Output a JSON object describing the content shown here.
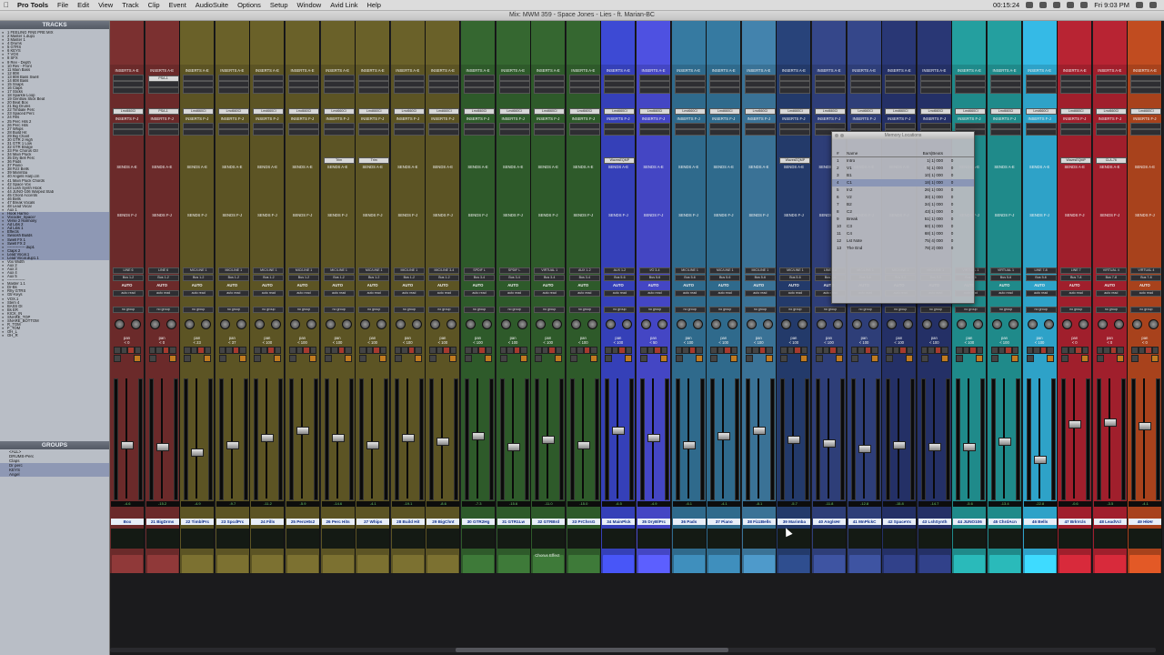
{
  "menubar": {
    "app": "Pro Tools",
    "items": [
      "File",
      "Edit",
      "View",
      "Track",
      "Clip",
      "Event",
      "AudioSuite",
      "Options",
      "Setup",
      "Window",
      "Avid Link",
      "Help"
    ],
    "time_code": "00:15:24",
    "clock": "Fri 9:03 PM"
  },
  "window": {
    "title": "Mix: MWM 359 - Space Jones - Lies - ft. Marian-BC"
  },
  "tracks_panel": {
    "header": "TRACKS",
    "items": [
      "1 FEELING FINE PRE MIX",
      "2 Master 1.dup1",
      "3 Master 1",
      "4 Drums",
      "5 GTRS",
      "6 KEYS",
      "7 VOX",
      "8 SFX",
      "9 Rev - Depth",
      "10 Rev - Front",
      "11 Main Bass",
      "12 808",
      "13 808 Bass Swell",
      "14 808 Bass",
      "15 Snaps",
      "16 Claps",
      "17 Sticks",
      "18 Sparkle Loop",
      "19 Gentlow Stick Beat",
      "20 Beat Box",
      "21 Big Drums",
      "22 Timbale Perc",
      "23 Spaced Perc",
      "24 Fills",
      "25 Perc Hits 2",
      "26 Perc Hits",
      "27 Whips",
      "28 Build Hit",
      "29 Big Chant",
      "30 GTR 2 High",
      "31 GTR 1 Low",
      "32 GTR Bridge",
      "33 Pre Chorus Gtr",
      "34 Main Pluck",
      "35 Dry Bell Perc",
      "36 Pads",
      "37 Piano",
      "38 Fizz Bells",
      "39 Marimba",
      "40 Angels Harp.cm",
      "41 Main Pluck Chords",
      "42 Space Vox",
      "43 Lush Synth Hook",
      "44 JUNO-106 Warped Stab",
      "45 Chord Accents",
      "46 Bells",
      "47 Break Vocals",
      "48 Lead Vocal",
      "Aux 1",
      "Hook Harmo",
      "Vocoder_Space/",
      "Verse 2 Harmony",
      "Ad Libs 2",
      "Ad Libs 1",
      "Effects",
      "Swoosh Builds",
      "Swell FX 1",
      "Swell FX 2",
      "-------------- dup1",
      "Claps 2",
      "Lead Vocal.1",
      "Lead Vocal.dup1.1",
      "Vox Width",
      "Aux 2",
      "Aux 3",
      "Aux 4",
      "Aux 5",
      "--------------",
      "Master 1.1",
      "Dr-Bs",
      "Rhy GTRS",
      "Gtr-Keys",
      "VOX.1",
      "Stem 4",
      "BASS DI",
      "Bs ER",
      "KICK_IN",
      "SNARE_TOP",
      "SNARE_BOTTOM",
      "R_TOM",
      "F_TOM",
      "OH_L",
      "OH_R"
    ]
  },
  "groups_panel": {
    "header": "GROUPS",
    "items": [
      "<ALL>",
      "DRUMS-Perc",
      "Claps",
      "Dr perc",
      "KEYS",
      "Angel"
    ]
  },
  "mixer": {
    "section_labels": {
      "inserts_a": "INSERTS A-E",
      "inserts_f": "INSERTS F-J",
      "sends_a": "SENDS A-E",
      "sends_f": "SENDS F-J"
    },
    "io_auto": "AUTO",
    "auto_mode": "auto read",
    "group": "no group",
    "pan": "pan",
    "strips": [
      {
        "name": "Box",
        "color": "#6b2a2a",
        "input": "LINE 6",
        "output": "Bus 1-2",
        "insert": "Lmd660Cl",
        "db": "-4.6",
        "pan": "< 0",
        "extra": "",
        "vol_val": ""
      },
      {
        "name": "21 BigDrms",
        "color": "#6b2a2a",
        "input": "LINE 6",
        "output": "Bus 1-2",
        "insert": "PSA-1",
        "db": "-15.2",
        "pan": "< 0",
        "extra": "",
        "vol_val": ""
      },
      {
        "name": "22 TimblPrc",
        "color": "#5c5424",
        "input": "MIC/LINE 1",
        "output": "Bus 1-2",
        "insert": "Lmd660Cl",
        "db": "-4.9",
        "pan": "< 23",
        "extra": "",
        "vol_val": ""
      },
      {
        "name": "23 SpcdPrc",
        "color": "#5c5424",
        "input": "MIC/LINE 1",
        "output": "Bus 1-2",
        "insert": "Lmd660Cl",
        "db": "-9.7",
        "pan": "< 37",
        "extra": "",
        "vol_val": ""
      },
      {
        "name": "24 Fills",
        "color": "#5c5424",
        "input": "MIC/LINE 1",
        "output": "Bus 1-2",
        "insert": "Lmd660Cl",
        "db": "-11.2",
        "pan": "< 100",
        "extra": "",
        "vol_val": ""
      },
      {
        "name": "25 PercHts2",
        "color": "#5c5424",
        "input": "MIC/LINE 1",
        "output": "Bus 1-2",
        "insert": "Lmd660Cl",
        "db": "-5.9",
        "pan": "< 100",
        "extra": "",
        "vol_val": ""
      },
      {
        "name": "26 Perc Hits",
        "color": "#5c5424",
        "input": "MIC/LINE 1",
        "output": "Bus 1-2",
        "insert": "Lmd660Cl",
        "db": "-14.6",
        "pan": "< 100",
        "extra": "Trim",
        "vol_val": ""
      },
      {
        "name": "27 Whips",
        "color": "#5c5424",
        "input": "MIC/LINE 1",
        "output": "Bus 1-2",
        "insert": "Lmd660Cl",
        "db": "-4.1",
        "pan": "< 100",
        "extra": "Trim",
        "vol_val": ""
      },
      {
        "name": "28 Build Hit",
        "color": "#5c5424",
        "input": "MIC/LINE 1",
        "output": "Bus 1-2",
        "insert": "Lmd660Cl",
        "db": "-19.1",
        "pan": "< 100",
        "extra": "",
        "vol_val": ""
      },
      {
        "name": "29 BigChnt",
        "color": "#5c5424",
        "input": "MIC/LINE 3-4",
        "output": "Bus 1-2",
        "insert": "Lmd660Cl",
        "db": "-8.6",
        "pan": "< 100",
        "extra": "",
        "vol_val": ""
      },
      {
        "name": "30 GTR2Hg",
        "color": "#2e5a2a",
        "input": "SPDIF L",
        "output": "Bus 3-4",
        "insert": "Lmd660Cl",
        "db": "-7.3",
        "pan": "< 100",
        "extra": "",
        "vol_val": ""
      },
      {
        "name": "31 GTR1Lw",
        "color": "#2e5a2a",
        "input": "SPDIF L",
        "output": "Bus 3-4",
        "insert": "Lmd660Cl",
        "db": "-15.6",
        "pan": "< 100",
        "extra": "",
        "vol_val": ""
      },
      {
        "name": "32 GTRBrd",
        "color": "#2e5a2a",
        "input": "VIRTUAL 1",
        "output": "Bus 3-4",
        "insert": "Lmd660Cl",
        "db": "-11.0",
        "pan": "< 100",
        "extra": "",
        "vol_val": ""
      },
      {
        "name": "33 PrChrsG",
        "color": "#2e5a2a",
        "input": "AUX 1-2",
        "output": "Bus 3-4",
        "insert": "Lmd660Cl",
        "db": "-15.0",
        "pan": "< 100",
        "extra": "",
        "vol_val": ""
      },
      {
        "name": "34 MainPlck",
        "color": "#3540b8",
        "input": "AUX 1-2",
        "output": "Bus 5-6",
        "insert": "Lmd660Cl",
        "db": "-6.5",
        "pan": "< 100",
        "extra": "WavesEQMP",
        "vol_val": ""
      },
      {
        "name": "35 DryBlPrc",
        "color": "#4446c4",
        "input": "I/O 3-4",
        "output": "Bus 5-6",
        "insert": "Lmd660Cl",
        "db": "-4.9",
        "pan": "< 50",
        "extra": "",
        "vol_val": ""
      },
      {
        "name": "36 Pads",
        "color": "#2f6a8c",
        "input": "MIC/LINE 1",
        "output": "Bus 5-6",
        "insert": "Lmd660Cl",
        "db": "-6.1",
        "pan": "< 100",
        "extra": "",
        "vol_val": ""
      },
      {
        "name": "37 Piano",
        "color": "#2f6a8c",
        "input": "MIC/LINE 1",
        "output": "Bus 5-6",
        "insert": "Lmd660Cl",
        "db": "-4.1",
        "pan": "< 100",
        "extra": "",
        "vol_val": ""
      },
      {
        "name": "38 FizzBells",
        "color": "#3a7296",
        "input": "MIC/LINE 1",
        "output": "Bus 5-6",
        "insert": "Lmd660Cl",
        "db": "-8.1",
        "pan": "< 100",
        "extra": "",
        "vol_val": ""
      },
      {
        "name": "39 Marimba",
        "color": "#233a6a",
        "input": "MIC/LINE 1",
        "output": "Bus 5-6",
        "insert": "Lmd660Cl",
        "db": "-5.7",
        "pan": "< 100",
        "extra": "WavesEQMP",
        "vol_val": ""
      },
      {
        "name": "40 AnglsHr",
        "color": "#2e3e78",
        "input": "LINE 5-6",
        "output": "Bus 5-6",
        "insert": "Lmd660Cl",
        "db": "-11.8",
        "pan": "< 100",
        "extra": "",
        "vol_val": ""
      },
      {
        "name": "41 MnPlckC",
        "color": "#2e3e78",
        "input": "MIC/LINE 1",
        "output": "Bus 5-6",
        "insert": "Lmd660Cl",
        "db": "-12.8",
        "pan": "< 100",
        "extra": "",
        "vol_val": ""
      },
      {
        "name": "42 SpaceVx",
        "color": "#243066",
        "input": "MIC/LINE 1",
        "output": "Bus 5-6",
        "insert": "Lmd660Cl",
        "db": "-15.8",
        "pan": "< 100",
        "extra": "",
        "vol_val": ""
      },
      {
        "name": "43 LshSynth",
        "color": "#243066",
        "input": "MIC/LINE 1",
        "output": "Bus 5-6",
        "insert": "Lmd660Cl",
        "db": "-14.7",
        "pan": "< 100",
        "extra": "",
        "vol_val": ""
      },
      {
        "name": "44 JUNO106",
        "color": "#1f8a8a",
        "input": "VIRTUAL 1",
        "output": "Bus 5-6",
        "insert": "Lmd660Cl",
        "db": "-5.6",
        "pan": "< 100",
        "extra": "",
        "vol_val": ""
      },
      {
        "name": "45 ChrdAcn",
        "color": "#1f8a8a",
        "input": "VIRTUAL 1",
        "output": "Bus 5-6",
        "insert": "Lmd660Cl",
        "db": "-13.4",
        "pan": "< 100",
        "extra": "",
        "vol_val": ""
      },
      {
        "name": "46 Bells",
        "color": "#2ea2c8",
        "input": "LINE 7-8",
        "output": "Bus 5-6",
        "insert": "Lmd660Cl",
        "db": "-22.8",
        "pan": "< 100",
        "extra": "",
        "vol_val": ""
      },
      {
        "name": "47 BrkVcls",
        "color": "#a01f2c",
        "input": "LINE 7",
        "output": "Bus 7-8",
        "insert": "Lmd660Cl",
        "db": "-0.6",
        "pan": "< 0",
        "extra": "WavesEQMP",
        "vol_val": ""
      },
      {
        "name": "48 LeadVcl",
        "color": "#a01f2c",
        "input": "VIRTUAL 4",
        "output": "Bus 7-8",
        "insert": "Lmd660Cl",
        "db": "-3.5",
        "pan": "< 0",
        "extra": "CLA-76",
        "vol_val": ""
      },
      {
        "name": "49 HkHr",
        "color": "#a8421c",
        "input": "VIRTUAL 4",
        "output": "Bus 7-8",
        "insert": "Lmd660Cl",
        "db": "-4.1",
        "pan": "< 0",
        "extra": "",
        "vol_val": ""
      }
    ],
    "chorus_effect_label": "Chorus Effect"
  },
  "memory_locations": {
    "title": "Memory Locations",
    "col_num": "#",
    "col_name": "Name",
    "col_bars": "Bars|Beats",
    "rows": [
      {
        "n": "1",
        "name": "Intro",
        "pos": "1| 1| 000",
        "mark": "0"
      },
      {
        "n": "2",
        "name": "V1",
        "pos": "5| 1| 000",
        "mark": "0"
      },
      {
        "n": "3",
        "name": "B1",
        "pos": "10| 1| 000",
        "mark": "0"
      },
      {
        "n": "4",
        "name": "C1",
        "pos": "18| 1| 000",
        "mark": "0"
      },
      {
        "n": "5",
        "name": "In2",
        "pos": "26| 1| 000",
        "mark": "0"
      },
      {
        "n": "6",
        "name": "V2",
        "pos": "30| 1| 000",
        "mark": "0"
      },
      {
        "n": "7",
        "name": "B2",
        "pos": "34| 1| 000",
        "mark": "0"
      },
      {
        "n": "8",
        "name": "C2",
        "pos": "43| 1| 000",
        "mark": "0"
      },
      {
        "n": "9",
        "name": "Break",
        "pos": "51| 1| 000",
        "mark": "0"
      },
      {
        "n": "10",
        "name": "C3",
        "pos": "60| 1| 000",
        "mark": "0"
      },
      {
        "n": "11",
        "name": "C4",
        "pos": "68| 1| 000",
        "mark": "0"
      },
      {
        "n": "12",
        "name": "Lst Note",
        "pos": "75| 4| 000",
        "mark": "0"
      },
      {
        "n": "13",
        "name": "The End",
        "pos": "78| 2| 000",
        "mark": "0"
      }
    ]
  }
}
